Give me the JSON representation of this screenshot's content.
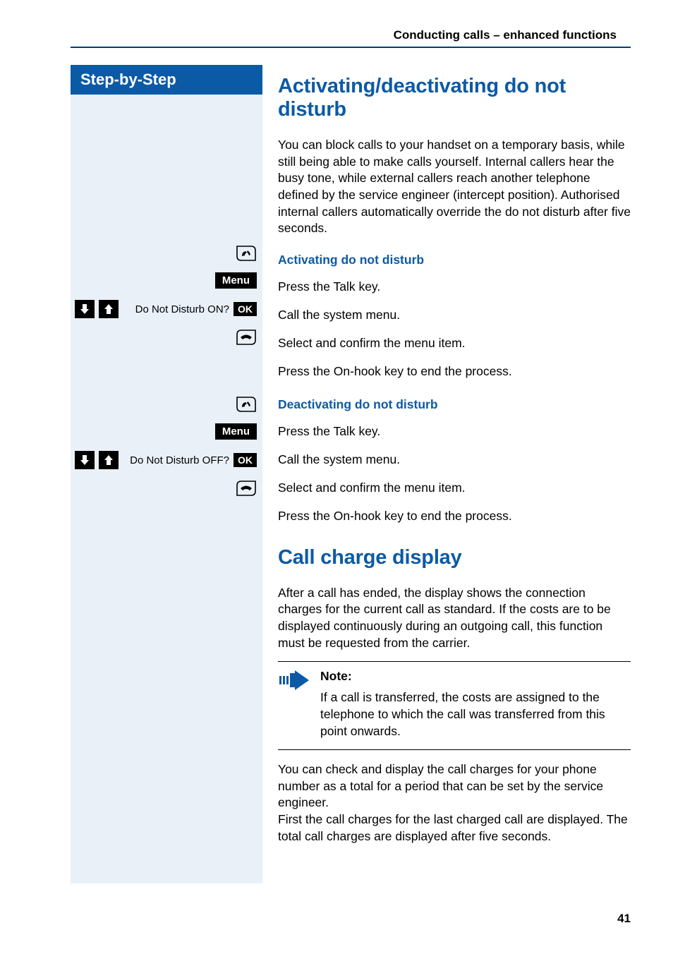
{
  "header": {
    "title": "Conducting calls – enhanced functions"
  },
  "sidebar": {
    "title": "Step-by-Step"
  },
  "icons": {
    "talk": "talk-key-icon",
    "onhook": "onhook-key-icon",
    "arrow_down": "arrow-down-icon",
    "arrow_up": "arrow-up-icon",
    "note": "note-arrow-icon"
  },
  "labels": {
    "menu": "Menu",
    "ok": "OK"
  },
  "activate": {
    "heading": "Activating/deactivating do not disturb",
    "intro": "You can block calls to your handset on a temporary basis, while still being able to make calls yourself. Internal callers hear the busy tone, while external callers reach another telephone defined by the service engineer (intercept position). Authorised internal callers automatically override the do not disturb after five seconds.",
    "sub_on": "Activating do not disturb",
    "sub_off": "Deactivating do not disturb",
    "steps_on": {
      "talk": "Press the Talk key.",
      "menu": "Call the system menu.",
      "select_label": "Do Not Disturb ON?",
      "select_text": "Select and confirm the menu item.",
      "onhook": "Press the On-hook key to end the process."
    },
    "steps_off": {
      "talk": "Press the Talk key.",
      "menu": "Call the system menu.",
      "select_label": "Do Not Disturb OFF?",
      "select_text": "Select and confirm the menu item.",
      "onhook": "Press the On-hook key to end the process."
    }
  },
  "charge": {
    "heading": "Call charge display",
    "intro": "After a call has ended, the display shows the connection charges for the current call as standard. If the costs are to be displayed continuously during an outgoing call, this function must be requested from the carrier.",
    "note_title": "Note:",
    "note_body": "If a call is transferred, the costs are assigned to the telephone to which the call was transferred from this point onwards.",
    "para2": "You can check and display the call charges for your phone number as a total for a period that can be set by the service engineer.\nFirst the call charges for the last charged call are displayed. The total call charges are displayed after five seconds."
  },
  "page_number": "41"
}
